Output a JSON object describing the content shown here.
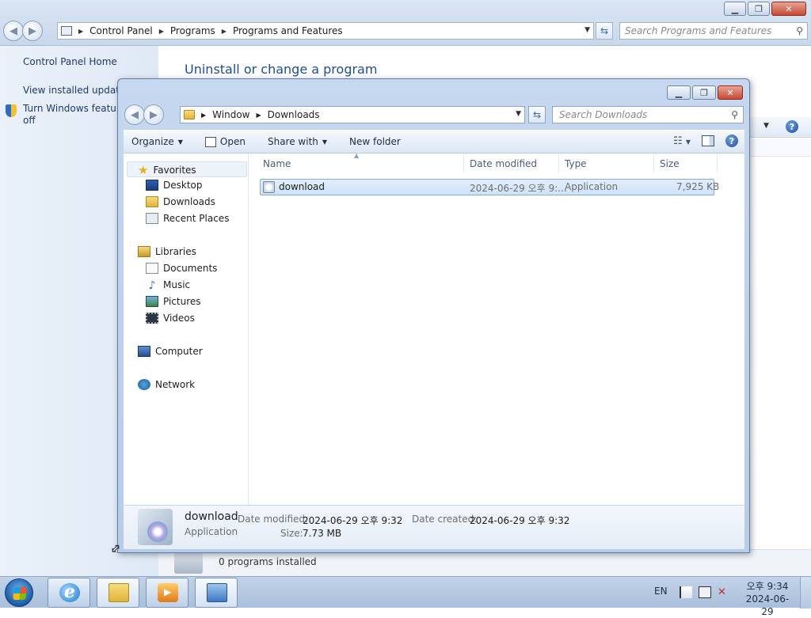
{
  "control_panel": {
    "breadcrumb": [
      "Control Panel",
      "Programs",
      "Programs and Features"
    ],
    "search_placeholder": "Search Programs and Features",
    "left_links": {
      "home": "Control Panel Home",
      "updates": "View installed updates",
      "features_line1": "Turn Windows features on or",
      "features_line2": "off"
    },
    "title": "Uninstall or change a program",
    "status_text": "0 programs installed",
    "help_glyph": "?"
  },
  "explorer": {
    "breadcrumb": [
      "Window",
      "Downloads"
    ],
    "search_placeholder": "Search Downloads",
    "toolbar": {
      "organize": "Organize",
      "open": "Open",
      "share_with": "Share with",
      "new_folder": "New folder",
      "help_glyph": "?"
    },
    "nav": {
      "favorites": "Favorites",
      "desktop": "Desktop",
      "downloads": "Downloads",
      "recent_places": "Recent Places",
      "libraries": "Libraries",
      "documents": "Documents",
      "music": "Music",
      "pictures": "Pictures",
      "videos": "Videos",
      "computer": "Computer",
      "network": "Network"
    },
    "columns": {
      "name": "Name",
      "date_modified": "Date modified",
      "type": "Type",
      "size": "Size"
    },
    "files": [
      {
        "name": "download",
        "date_modified": "2024-06-29 오후 9:...",
        "type": "Application",
        "size": "7,925 KB",
        "selected": true
      }
    ],
    "details": {
      "name": "download",
      "type": "Application",
      "date_modified_label": "Date modified:",
      "date_modified_value": "2024-06-29 오후 9:32",
      "date_created_label": "Date created:",
      "date_created_value": "2024-06-29 오후 9:32",
      "size_label": "Size:",
      "size_value": "7.73 MB"
    }
  },
  "taskbar": {
    "language": "EN",
    "time": "오후 9:34",
    "date": "2024-06-29",
    "pinned": [
      "internet-explorer",
      "windows-explorer",
      "media-player",
      "control-panel"
    ]
  },
  "colors": {
    "link": "#1e3a6e",
    "title_blue": "#1e4e91",
    "selection": "#cfe3f8",
    "taskbar": "#a9bfdb"
  }
}
